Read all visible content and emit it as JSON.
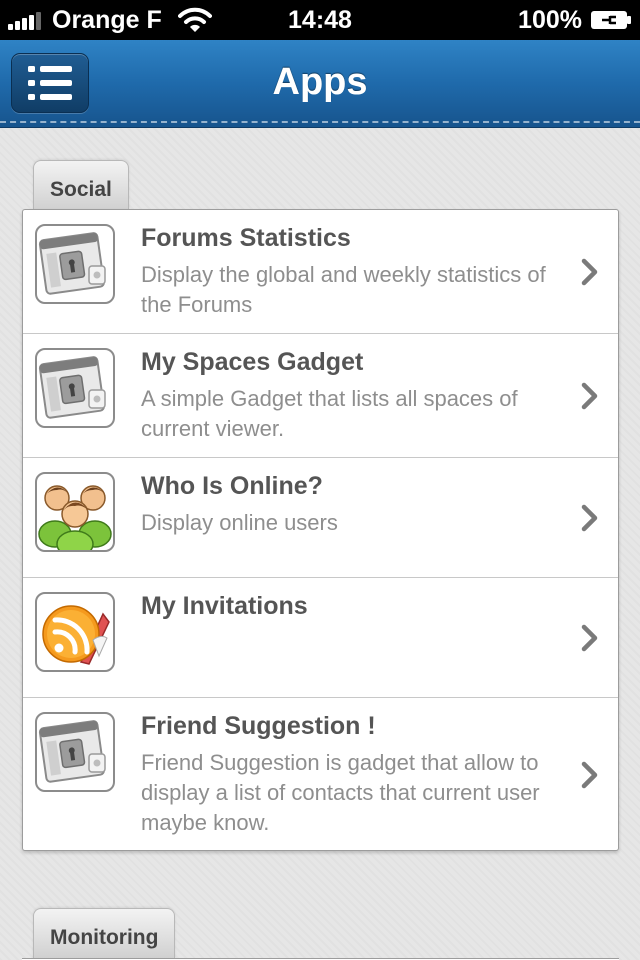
{
  "status_bar": {
    "carrier": "Orange F",
    "time": "14:48",
    "battery": "100%"
  },
  "nav": {
    "title": "Apps",
    "menu_icon": "list-menu-icon"
  },
  "sections": [
    {
      "title": "Social",
      "items": [
        {
          "title": "Forums Statistics",
          "description": "Display the global and weekly statistics of the Forums",
          "icon": "gadget-icon"
        },
        {
          "title": "My Spaces Gadget",
          "description": "A simple Gadget that lists all spaces of current viewer.",
          "icon": "gadget-icon"
        },
        {
          "title": "Who Is Online?",
          "description": "Display online users",
          "icon": "users-icon"
        },
        {
          "title": "My Invitations",
          "description": "",
          "icon": "rss-feed-icon"
        },
        {
          "title": "Friend Suggestion !",
          "description": "Friend Suggestion is gadget that allow to display a list of contacts that current user maybe know.",
          "icon": "gadget-icon"
        }
      ]
    },
    {
      "title": "Monitoring",
      "items": []
    }
  ],
  "colors": {
    "nav_blue": "#1f6aab",
    "title_text": "#555555",
    "desc_text": "#8e8e8e",
    "background": "#e6e6e6"
  }
}
